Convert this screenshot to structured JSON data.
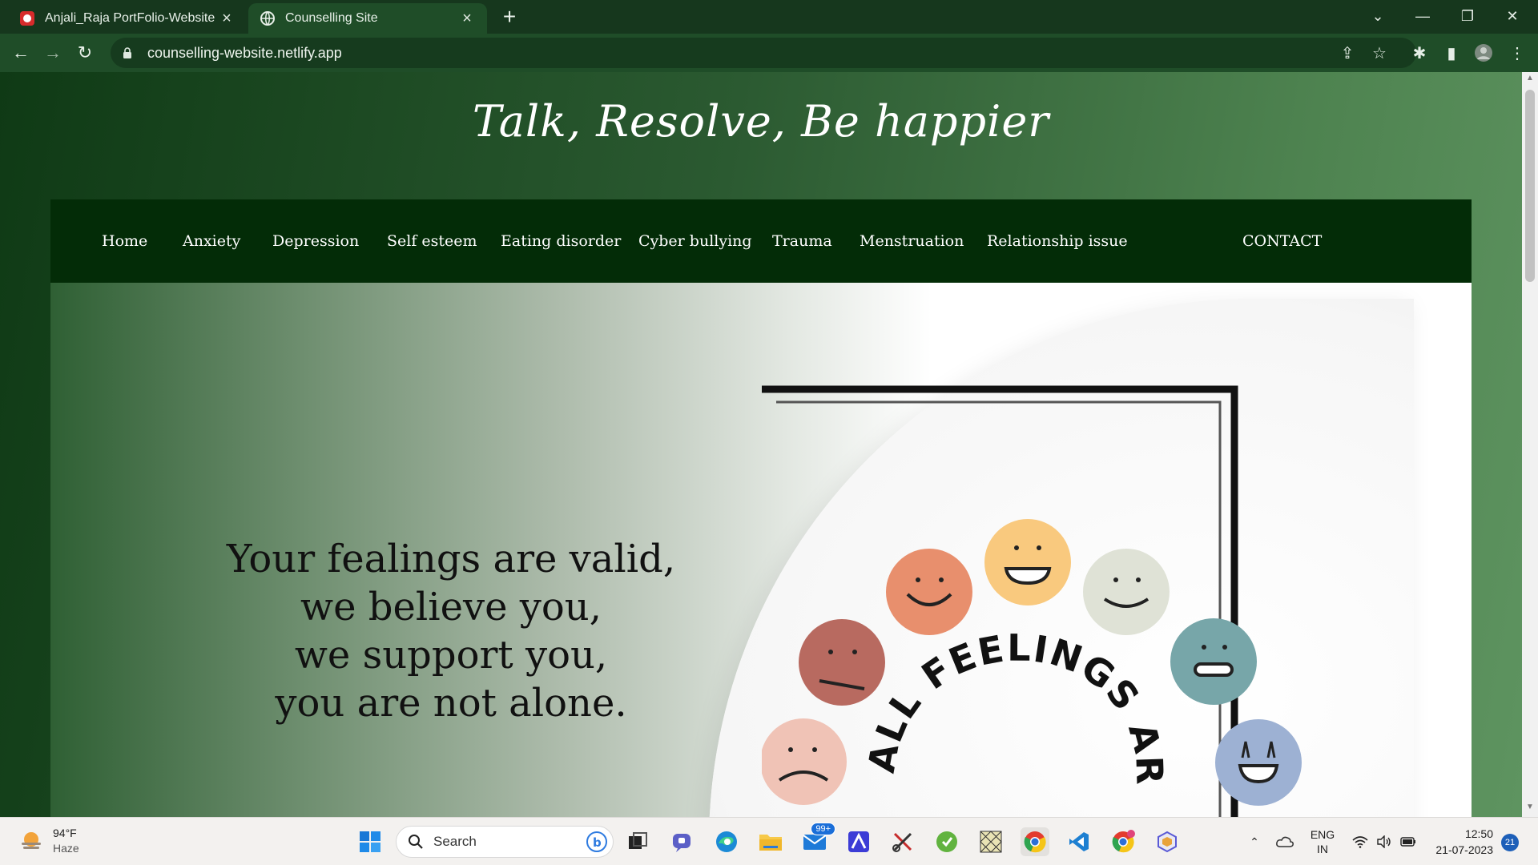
{
  "browser": {
    "tabs": [
      {
        "title": "Anjali_Raja PortFolio-Website",
        "active": false
      },
      {
        "title": "Counselling Site",
        "active": true
      }
    ],
    "url": "counselling-website.netlify.app"
  },
  "site": {
    "title": "Talk, Resolve, Be happier",
    "nav": [
      "Home",
      "Anxiety",
      "Depression",
      "Self esteem",
      "Eating disorder",
      "Cyber bullying",
      "Trauma",
      "Menstruation",
      "Relationship issue"
    ],
    "contact": "CONTACT",
    "hero_lines": [
      "Your fealings are valid,",
      "we believe you,",
      "we support you,",
      "you are not alone."
    ],
    "image_text": "ALL FEELINGS ARE VALID"
  },
  "taskbar": {
    "weather_temp": "94°F",
    "weather_desc": "Haze",
    "search_placeholder": "Search",
    "mail_badge": "99+",
    "lang_top": "ENG",
    "lang_bottom": "IN",
    "time": "12:50",
    "date": "21-07-2023",
    "notifications": "21"
  },
  "colors": {
    "nav_bg": "#032c07",
    "page_bg": "#1b4a22",
    "chrome_bg": "#1f4d28"
  }
}
